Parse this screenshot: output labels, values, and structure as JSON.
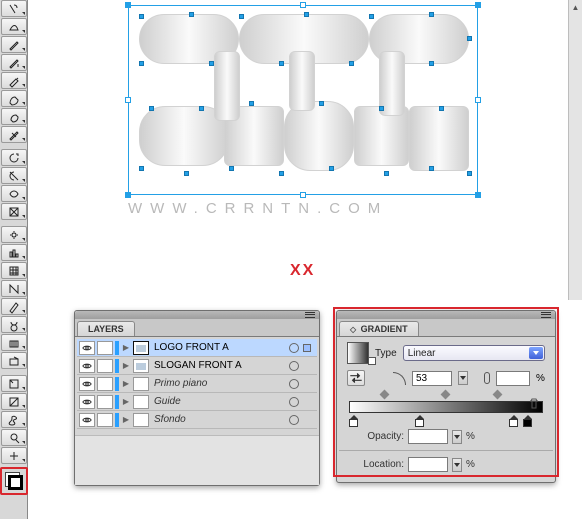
{
  "toolbar": {
    "tools": [
      {
        "name": "magic-wand-icon",
        "interact": true
      },
      {
        "name": "lasso-icon",
        "interact": true
      },
      {
        "name": "pen-icon",
        "interact": true
      },
      {
        "name": "pen-add-icon",
        "interact": true
      },
      {
        "name": "pencil-icon",
        "interact": true
      },
      {
        "name": "brush-icon",
        "interact": true
      },
      {
        "name": "blob-brush-icon",
        "interact": true
      },
      {
        "name": "eraser-icon",
        "interact": true
      },
      {
        "name": "rotate-icon",
        "interact": true
      },
      {
        "name": "reflect-icon",
        "interact": true
      },
      {
        "name": "warp-icon",
        "interact": true
      },
      {
        "name": "free-transform-icon",
        "interact": true
      },
      {
        "name": "symbol-sprayer-icon",
        "interact": true
      },
      {
        "name": "column-graph-icon",
        "interact": true
      },
      {
        "name": "mesh-icon",
        "interact": true
      },
      {
        "name": "gradient-tool-icon",
        "interact": true
      },
      {
        "name": "eyedropper-icon",
        "interact": true
      },
      {
        "name": "blend-icon",
        "interact": true
      },
      {
        "name": "live-paint-icon",
        "interact": true
      },
      {
        "name": "live-paint-select-icon",
        "interact": true
      },
      {
        "name": "artboard-icon",
        "interact": true
      },
      {
        "name": "slice-icon",
        "interact": true
      },
      {
        "name": "hand-icon",
        "interact": true
      },
      {
        "name": "zoom-icon",
        "interact": true
      },
      {
        "name": "toggle-fill-stroke-icon",
        "interact": true
      }
    ]
  },
  "canvas": {
    "url_text": "WWW.CRRNTN.COM",
    "marker": "XX"
  },
  "layers_panel": {
    "title": "LAYERS",
    "rows": [
      {
        "name": "LOGO FRONT A",
        "selected": true,
        "italic": false,
        "target": true
      },
      {
        "name": "SLOGAN FRONT A",
        "selected": false,
        "italic": false,
        "target": false
      },
      {
        "name": "Primo piano",
        "selected": false,
        "italic": true,
        "target": false
      },
      {
        "name": "Guide",
        "selected": false,
        "italic": true,
        "target": false
      },
      {
        "name": "Sfondo",
        "selected": false,
        "italic": true,
        "target": false
      }
    ]
  },
  "gradient_panel": {
    "title": "GRADIENT",
    "type_label": "Type",
    "type_value": "Linear",
    "angle_value": "53",
    "aspect_value": "",
    "aspect_unit": "%",
    "opacity_label": "Opacity:",
    "opacity_value": "",
    "opacity_unit": "%",
    "location_label": "Location:",
    "location_value": "",
    "location_unit": "%",
    "diamonds": [
      15,
      50,
      80
    ],
    "stops": [
      {
        "pos": 0,
        "black": false
      },
      {
        "pos": 38,
        "black": false
      },
      {
        "pos": 92,
        "black": false
      },
      {
        "pos": 100,
        "black": true
      }
    ]
  }
}
